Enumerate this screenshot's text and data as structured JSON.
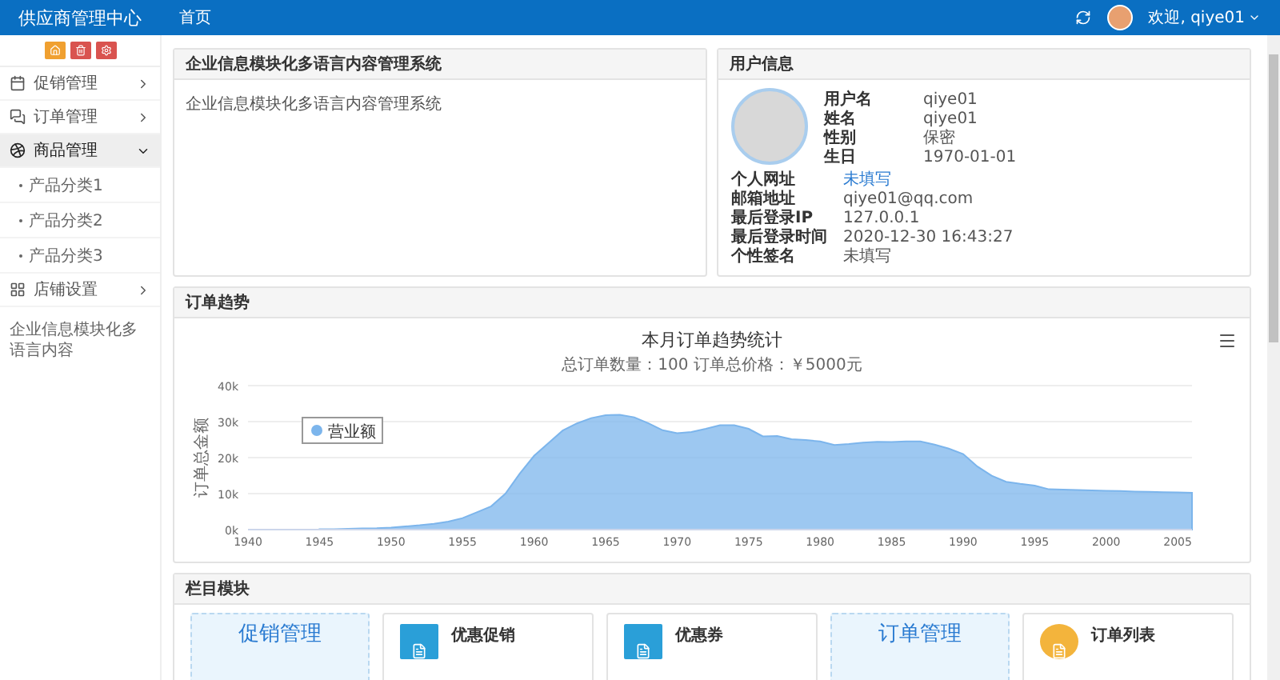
{
  "header": {
    "brand": "供应商管理中心",
    "nav": [
      {
        "label": "首页",
        "selected": true
      }
    ],
    "user": "欢迎, qiye01"
  },
  "sidebar": {
    "quick_buttons": [
      {
        "color": "#f0a030"
      },
      {
        "color": "#d9534f"
      },
      {
        "color": "#d9534f"
      }
    ],
    "items": [
      {
        "label": "促销管理",
        "expanded": false
      },
      {
        "label": "订单管理",
        "expanded": false
      },
      {
        "label": "商品管理",
        "expanded": true,
        "children": [
          {
            "label": "产品分类1"
          },
          {
            "label": "产品分类2"
          },
          {
            "label": "产品分类3"
          }
        ]
      },
      {
        "label": "店铺设置",
        "expanded": false
      }
    ],
    "footer": "企业信息模块化多语言内容"
  },
  "intro_panel": {
    "title": "企业信息模块化多语言内容管理系统",
    "text": "企业信息模块化多语言内容管理系统"
  },
  "user_panel": {
    "title": "用户信息",
    "top_fields": [
      {
        "label": "用户名",
        "value": "qiye01"
      },
      {
        "label": "姓名",
        "value": "qiye01"
      },
      {
        "label": "性别",
        "value": "保密"
      },
      {
        "label": "生日",
        "value": "1970-01-01"
      }
    ],
    "fields": [
      {
        "label": "个人网址",
        "value": "未填写",
        "kind": "link"
      },
      {
        "label": "邮箱地址",
        "value": "qiye01@qq.com",
        "kind": "text"
      },
      {
        "label": "最后登录IP",
        "value": "127.0.0.1",
        "kind": "text"
      },
      {
        "label": "最后登录时间",
        "value": "2020-12-30 16:43:27",
        "kind": "text"
      },
      {
        "label": "个性签名",
        "value": "未填写",
        "kind": "text"
      }
    ]
  },
  "trend_panel": {
    "title": "订单趋势",
    "chart_data": {
      "type": "area",
      "title": "本月订单趋势统计",
      "subtitle": "总订单数量：100 订单总价格：￥5000元",
      "ylabel": "订单总金额",
      "x": [
        1945,
        1946,
        1947,
        1948,
        1949,
        1950,
        1951,
        1952,
        1953,
        1954,
        1955,
        1956,
        1957,
        1958,
        1959,
        1960,
        1961,
        1962,
        1963,
        1964,
        1965,
        1966,
        1967,
        1968,
        1969,
        1970,
        1971,
        1972,
        1973,
        1974,
        1975,
        1976,
        1977,
        1978,
        1979,
        1980,
        1981,
        1982,
        1983,
        1984,
        1985,
        1986,
        1987,
        1988,
        1989,
        1990,
        1991,
        1992,
        1993,
        1994,
        1995,
        1996,
        1997,
        1998,
        1999,
        2000,
        2001,
        2002,
        2003,
        2004,
        2005,
        2006
      ],
      "series": [
        {
          "name": "营业额",
          "color": "#7cb5ec",
          "values": [
            100,
            100,
            200,
            300,
            400,
            600,
            900,
            1200,
            1600,
            2200,
            3200,
            4800,
            6500,
            10000,
            15500,
            20500,
            24000,
            27500,
            29500,
            31000,
            31800,
            31900,
            31200,
            29500,
            27600,
            26800,
            27100,
            28000,
            29000,
            29000,
            28000,
            25900,
            26000,
            25100,
            24900,
            24500,
            23500,
            23800,
            24200,
            24400,
            24300,
            24500,
            24500,
            23600,
            22500,
            21000,
            17500,
            15000,
            13300,
            12700,
            12200,
            11200,
            11100,
            11000,
            10900,
            10800,
            10700,
            10600,
            10500,
            10400,
            10300,
            10200
          ]
        }
      ],
      "xlim": [
        1940,
        2006
      ],
      "ylim": [
        0,
        40000
      ],
      "grid": true,
      "xticks": [
        1940,
        1945,
        1950,
        1955,
        1960,
        1965,
        1970,
        1975,
        1980,
        1985,
        1990,
        1995,
        2000,
        2005
      ],
      "yticks": [
        {
          "value": 0,
          "label": "0k"
        },
        {
          "value": 10000,
          "label": "10k"
        },
        {
          "value": 20000,
          "label": "20k"
        },
        {
          "value": 30000,
          "label": "30k"
        },
        {
          "value": 40000,
          "label": "40k"
        }
      ]
    }
  },
  "modules_panel": {
    "title": "栏目模块",
    "cards": [
      {
        "kind": "big",
        "title": "促销管理"
      },
      {
        "kind": "icon",
        "title": "优惠促销",
        "color": "#2a9fd8"
      },
      {
        "kind": "icon",
        "title": "优惠券",
        "color": "#2a9fd8"
      },
      {
        "kind": "big",
        "title": "订单管理"
      },
      {
        "kind": "round",
        "title": "订单列表",
        "color": "#f3b43c"
      }
    ]
  }
}
